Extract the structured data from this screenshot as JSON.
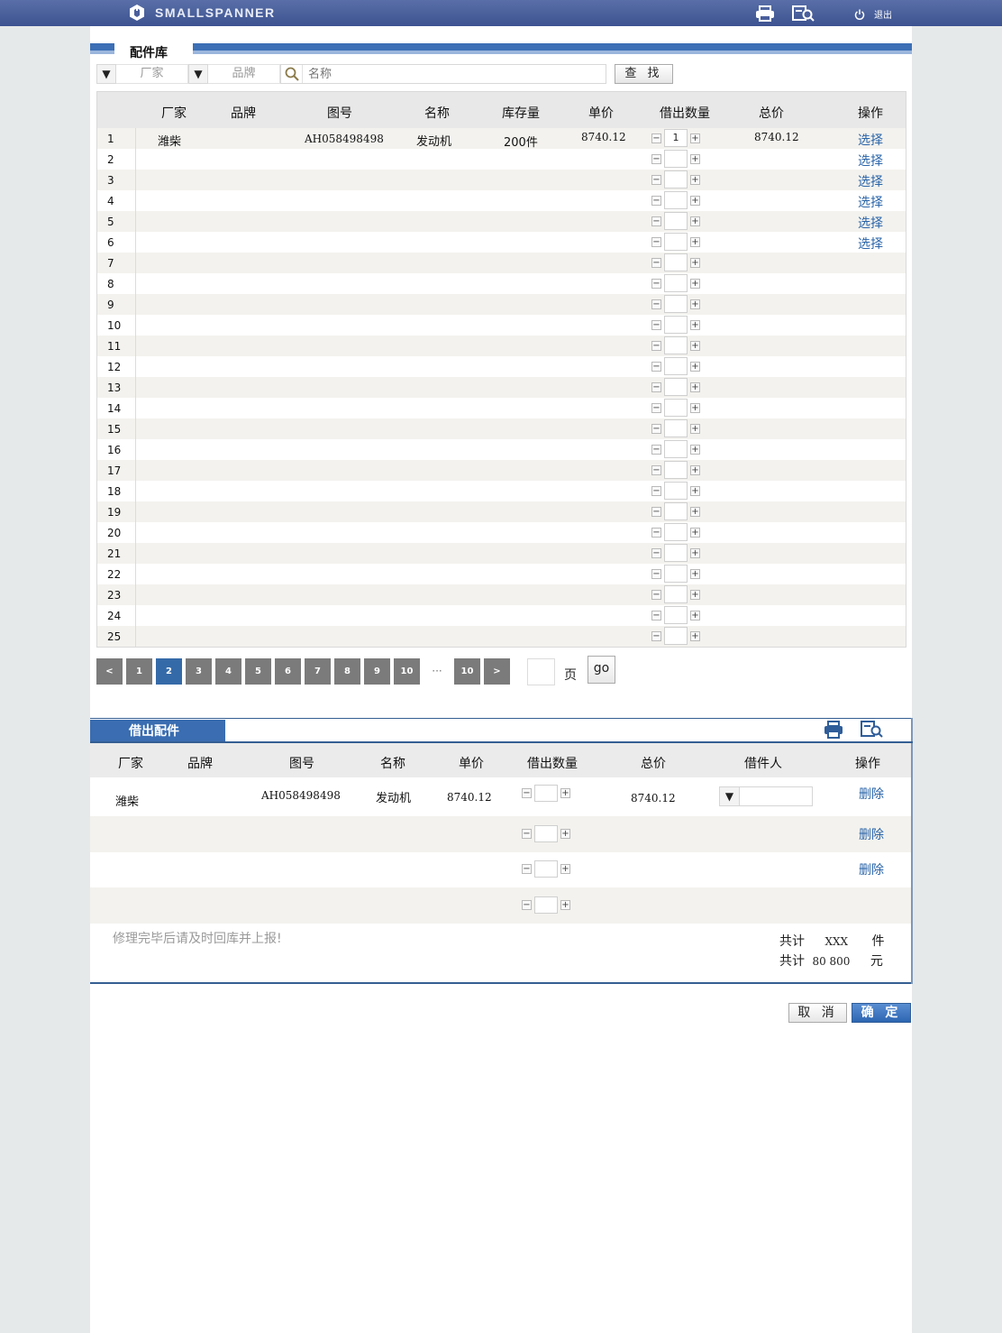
{
  "app": {
    "brand": "SMALLSPANNER",
    "logout_label": "退出"
  },
  "stock_section": {
    "title": "配件库",
    "search": {
      "manufacturer_placeholder": "厂家",
      "brand_placeholder": "品牌",
      "name_placeholder": "名称",
      "button_label": "查 找"
    },
    "columns": [
      "厂家",
      "品牌",
      "图号",
      "名称",
      "库存量",
      "单价",
      "借出数量",
      "总价",
      "操作"
    ],
    "rows": [
      {
        "index": "1",
        "manufacturer": "潍柴",
        "brand": "",
        "part_no": "AH058498498",
        "name": "发动机",
        "stock": "200件",
        "unit_price": "8740.12",
        "qty": "1",
        "total": "8740.12",
        "action": "选择"
      },
      {
        "index": "2",
        "qty": "",
        "action": "选择"
      },
      {
        "index": "3",
        "qty": "",
        "action": "选择"
      },
      {
        "index": "4",
        "qty": "",
        "action": "选择"
      },
      {
        "index": "5",
        "qty": "",
        "action": "选择"
      },
      {
        "index": "6",
        "qty": "",
        "action": "选择"
      },
      {
        "index": "7",
        "qty": ""
      },
      {
        "index": "8",
        "qty": ""
      },
      {
        "index": "9",
        "qty": ""
      },
      {
        "index": "10",
        "qty": ""
      },
      {
        "index": "11",
        "qty": ""
      },
      {
        "index": "12",
        "qty": ""
      },
      {
        "index": "13",
        "qty": ""
      },
      {
        "index": "14",
        "qty": ""
      },
      {
        "index": "15",
        "qty": ""
      },
      {
        "index": "16",
        "qty": ""
      },
      {
        "index": "17",
        "qty": ""
      },
      {
        "index": "18",
        "qty": ""
      },
      {
        "index": "19",
        "qty": ""
      },
      {
        "index": "20",
        "qty": ""
      },
      {
        "index": "21",
        "qty": ""
      },
      {
        "index": "22",
        "qty": ""
      },
      {
        "index": "23",
        "qty": ""
      },
      {
        "index": "24",
        "qty": ""
      },
      {
        "index": "25",
        "qty": ""
      }
    ],
    "pagination": {
      "prev": "<",
      "next": ">",
      "pages": [
        "1",
        "2",
        "3",
        "4",
        "5",
        "6",
        "7",
        "8",
        "9",
        "10"
      ],
      "current": "2",
      "ellipsis": "···",
      "last": "10",
      "page_input": "",
      "page_label": "页",
      "go_label": "go"
    }
  },
  "borrow_section": {
    "tab_label": "借出配件",
    "columns": [
      "厂家",
      "品牌",
      "图号",
      "名称",
      "单价",
      "借出数量",
      "总价",
      "借件人",
      "操作"
    ],
    "rows": [
      {
        "manufacturer": "潍柴",
        "part_no": "AH058498498",
        "name": "发动机",
        "unit_price": "8740.12",
        "qty": "",
        "total": "8740.12",
        "borrower": "",
        "action": "删除"
      },
      {
        "qty": "",
        "action": "删除"
      },
      {
        "qty": "",
        "action": "删除"
      },
      {
        "qty": ""
      }
    ],
    "note": "修理完毕后请及时回库并上报!",
    "total_count_label": "共计",
    "total_count_value": "XXX",
    "total_count_unit": "件",
    "total_price_label": "共计",
    "total_price_value": "80 800",
    "total_price_unit": "元"
  },
  "footer": {
    "cancel_label": "取 消",
    "confirm_label": "确 定"
  },
  "colors": {
    "accent": "#3a6db1",
    "topbar": "#4a5f9c",
    "link": "#2a64a8"
  },
  "icons": [
    "logo-icon",
    "print-icon",
    "print-preview-icon",
    "power-icon",
    "search-icon",
    "dropdown-arrow-icon"
  ]
}
